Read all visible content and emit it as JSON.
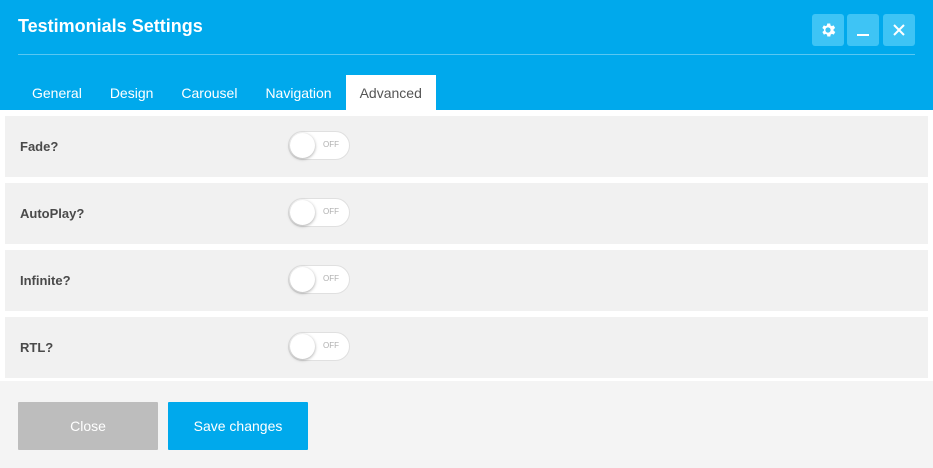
{
  "dialog": {
    "title": "Testimonials Settings",
    "header_buttons": [
      {
        "name": "settings",
        "icon": "gear-icon"
      },
      {
        "name": "minimize",
        "icon": "minimize-icon"
      },
      {
        "name": "close",
        "icon": "close-icon"
      }
    ]
  },
  "tabs": [
    {
      "label": "General"
    },
    {
      "label": "Design"
    },
    {
      "label": "Carousel"
    },
    {
      "label": "Navigation"
    },
    {
      "label": "Advanced",
      "active": true
    }
  ],
  "settings": [
    {
      "label": "Fade?",
      "toggle_text": "OFF"
    },
    {
      "label": "AutoPlay?",
      "toggle_text": "OFF"
    },
    {
      "label": "Infinite?",
      "toggle_text": "OFF"
    },
    {
      "label": "RTL?",
      "toggle_text": "OFF"
    }
  ],
  "footer": {
    "close_label": "Close",
    "save_label": "Save changes"
  },
  "colors": {
    "accent": "#00a9ec",
    "header_button": "#3ec4f5",
    "row_background": "#f1f1f1",
    "close_button": "#bdbdbd"
  }
}
